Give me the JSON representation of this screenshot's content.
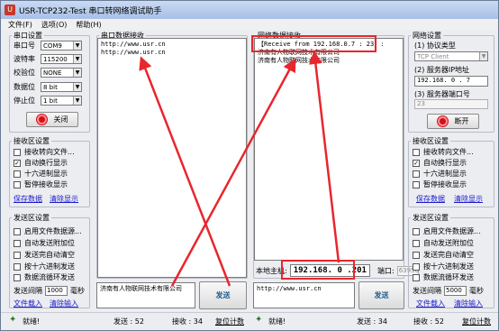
{
  "window": {
    "title": "USR-TCP232-Test 串口转网络调试助手",
    "app_icon_glyph": "U"
  },
  "menu": [
    "文件(F)",
    "选项(O)",
    "帮助(H)"
  ],
  "serial_settings": {
    "title": "串口设置",
    "fields": [
      {
        "label": "串口号",
        "value": "COM9"
      },
      {
        "label": "波特率",
        "value": "115200"
      },
      {
        "label": "校验位",
        "value": "NONE"
      },
      {
        "label": "数据位",
        "value": "8 bit"
      },
      {
        "label": "停止位",
        "value": "1 bit"
      }
    ],
    "button": "关闭"
  },
  "left_receive": {
    "title": "接收区设置",
    "options": [
      {
        "label": "接收转向文件...",
        "checked": false
      },
      {
        "label": "自动换行显示",
        "checked": true
      },
      {
        "label": "十六进制显示",
        "checked": false
      },
      {
        "label": "暂停接收显示",
        "checked": false
      }
    ],
    "link_save": "保存数据",
    "link_clear": "清除显示"
  },
  "left_send": {
    "title": "发送区设置",
    "options": [
      {
        "label": "启用文件数据源...",
        "checked": false
      },
      {
        "label": "自动发送附加位",
        "checked": false
      },
      {
        "label": "发送完自动清空",
        "checked": false
      },
      {
        "label": "按十六进制发送",
        "checked": false
      },
      {
        "label": "数据流循环发送",
        "checked": false
      }
    ],
    "interval_label": "发送间隔",
    "interval_value": "1000",
    "interval_unit": "毫秒",
    "link_load": "文件载入",
    "link_clear": "清除输入"
  },
  "serial_receive": {
    "title": "串口数据接收",
    "lines": [
      "http://www.usr.cn",
      "http://www.usr.cn"
    ]
  },
  "serial_send": {
    "text": "济南有人物联网技术有限公司",
    "button": "发送"
  },
  "net_receive": {
    "title": "网络数据接收",
    "lines": [
      "【Receive from 192.168.0.7 : 23】:",
      "济南有人物联网技术有限公司",
      "济南有人物联网技术有限公司"
    ]
  },
  "net_host": {
    "host_label": "本地主机:",
    "host_value": "192.168. 0 .201",
    "port_label": "端口:",
    "port_value": "63956"
  },
  "net_send": {
    "text": "http://www.usr.cn",
    "button": "发送"
  },
  "net_settings": {
    "title": "网络设置",
    "protocol_label": "(1) 协议类型",
    "protocol_value": "TCP Client",
    "server_ip_label": "(2) 服务器IP地址",
    "server_ip_value": "192.168. 0 . 7",
    "server_port_label": "(3) 服务器端口号",
    "server_port_value": "23",
    "button": "断开"
  },
  "right_receive": {
    "title": "接收区设置",
    "options": [
      {
        "label": "接收转向文件...",
        "checked": false
      },
      {
        "label": "自动换行显示",
        "checked": true
      },
      {
        "label": "十六进制显示",
        "checked": false
      },
      {
        "label": "暂停接收显示",
        "checked": false
      }
    ],
    "link_save": "保存数据",
    "link_clear": "清除显示"
  },
  "right_send": {
    "title": "发送区设置",
    "options": [
      {
        "label": "启用文件数据源...",
        "checked": false
      },
      {
        "label": "自动发送附加位",
        "checked": false
      },
      {
        "label": "发送完自动清空",
        "checked": false
      },
      {
        "label": "按十六进制发送",
        "checked": false
      },
      {
        "label": "数据流循环发送",
        "checked": false
      }
    ],
    "interval_label": "发送间隔",
    "interval_value": "5000",
    "interval_unit": "毫秒",
    "link_load": "文件载入",
    "link_clear": "清除输入"
  },
  "status_left": {
    "ready": "就绪!",
    "send": "发送 : 52",
    "recv": "接收 : 34",
    "reset": "复位计数"
  },
  "status_right": {
    "ready": "就绪!",
    "send": "发送 : 34",
    "recv": "接收 : 52",
    "reset": "复位计数"
  },
  "colors": {
    "highlight": "#e8262d",
    "arrow": "#e8262d",
    "link": "#1a1acc"
  }
}
